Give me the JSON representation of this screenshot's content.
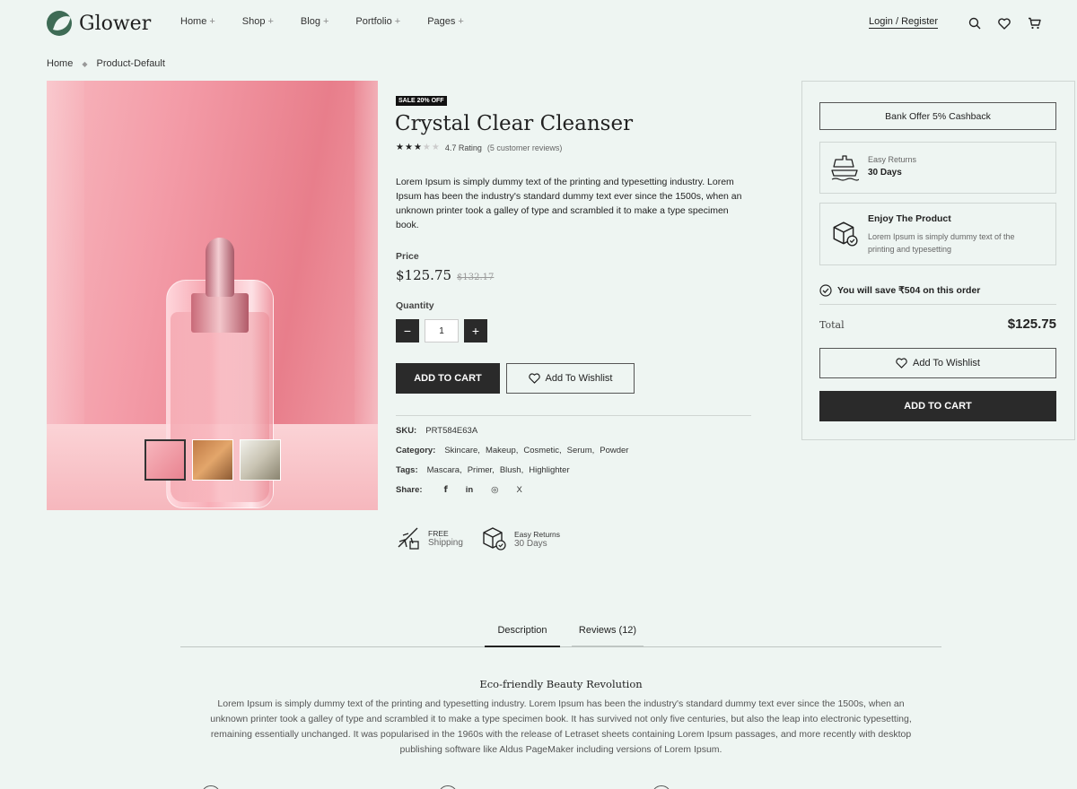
{
  "brand": {
    "name": "Glower"
  },
  "nav": {
    "items": [
      "Home",
      "Shop",
      "Blog",
      "Portfolio",
      "Pages"
    ],
    "plus": "+"
  },
  "header": {
    "login": "Login / Register",
    "icons": [
      "search-icon",
      "heart-icon",
      "cart-icon"
    ]
  },
  "breadcrumb": {
    "home": "Home",
    "current": "Product-Default",
    "separator": "◆"
  },
  "product": {
    "badge": "SALE 20% OFF",
    "title": "Crystal Clear Cleanser",
    "rating_value": 3,
    "rating_max": 5,
    "rating_text": "4.7 Rating",
    "reviews_text": "(5 customer reviews)",
    "description": "Lorem Ipsum is simply dummy text of the printing and typesetting industry. Lorem Ipsum has been the industry's standard dummy text ever since the 1500s, when an unknown printer took a galley of type and scrambled it to make a type specimen book.",
    "price_label": "Price",
    "price": "$125.75",
    "old_price": "$132.17",
    "quantity_label": "Quantity",
    "quantity": "1",
    "add_to_cart": "ADD TO CART",
    "add_to_wishlist": "Add To Wishlist",
    "sku_label": "SKU:",
    "sku": "PRT584E63A",
    "category_label": "Category:",
    "categories": [
      "Skincare,",
      "Makeup,",
      "Cosmetic,",
      "Serum,",
      "Powder"
    ],
    "tags_label": "Tags:",
    "tags": [
      "Mascara,",
      "Primer,",
      "Blush,",
      "Highlighter"
    ],
    "share_label": "Share:",
    "share_icons": [
      "f",
      "in",
      "◎",
      "X"
    ],
    "features": [
      {
        "line1": "FREE",
        "line2": "Shipping"
      },
      {
        "line1": "Easy Returns",
        "line2": "30 Days"
      }
    ]
  },
  "panel": {
    "bank_offer": "Bank Offer 5% Cashback",
    "returns_title": "Easy Returns",
    "returns_sub": "30 Days",
    "enjoy_title": "Enjoy The Product",
    "enjoy_sub": "Lorem Ipsum is simply dummy text of the printing and typesetting",
    "save_text": "You will save ₹504 on this order",
    "total_label": "Total",
    "total_value": "$125.75",
    "wishlist": "Add To Wishlist",
    "add_to_cart": "ADD TO CART"
  },
  "tabs": {
    "description": "Description",
    "reviews": "Reviews (12)"
  },
  "section": {
    "title": "Eco-friendly Beauty Revolution",
    "body": "Lorem Ipsum is simply dummy text of the printing and typesetting industry. Lorem Ipsum has been the industry's standard dummy text ever since the 1500s, when an unknown printer took a galley of type and scrambled it to make a type specimen book. It has survived not only five centuries, but also the leap into electronic typesetting, remaining essentially unchanged. It was popularised in the 1960s with the release of Letraset sheets containing Lorem Ipsum passages, and more recently with desktop publishing software like Aldus PageMaker including versions of Lorem Ipsum."
  }
}
